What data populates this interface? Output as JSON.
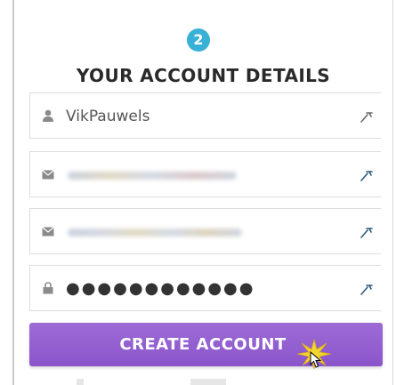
{
  "step": {
    "number": "2"
  },
  "form": {
    "title": "YOUR ACCOUNT DETAILS",
    "fields": [
      {
        "type": "username",
        "icon": "user-icon",
        "value": "VikPauwels",
        "action_icon": "wrench-icon"
      },
      {
        "type": "email",
        "icon": "envelope-icon",
        "value_obscured": true,
        "action_icon": "wrench-icon"
      },
      {
        "type": "email-confirm",
        "icon": "envelope-icon",
        "value_obscured": true,
        "action_icon": "wrench-icon"
      },
      {
        "type": "password",
        "icon": "lock-icon",
        "value": "●●●●●●●●●●●●",
        "action_icon": "wrench-icon"
      }
    ],
    "submit_label": "CREATE ACCOUNT"
  },
  "colors": {
    "step_badge": "#39b1d6",
    "button": "#8f5ccf",
    "title_text": "#2a2a2a",
    "field_border": "#dcdcdc",
    "click_burst": "#f2d52e"
  }
}
